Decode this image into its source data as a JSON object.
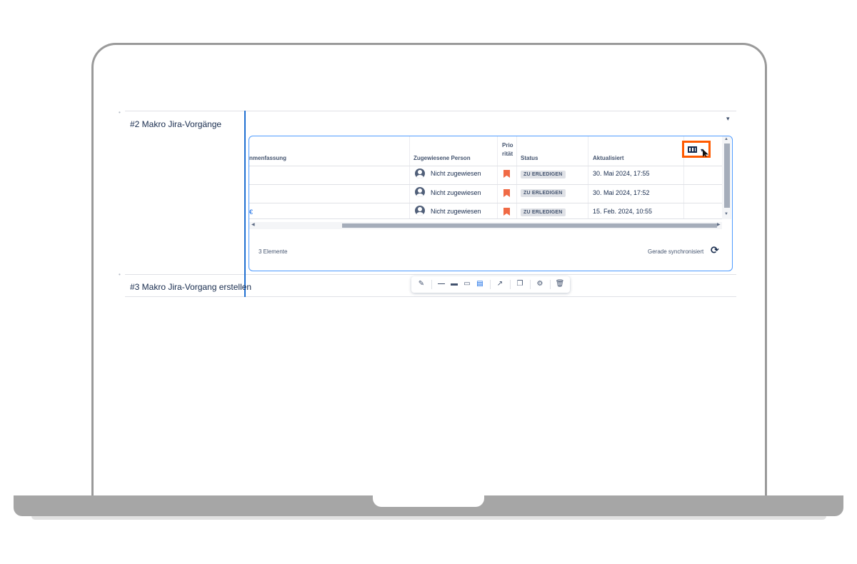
{
  "doc_rows": [
    {
      "label": "#2 Makro Jira-Vorgänge"
    },
    {
      "label": "#3 Makro Jira-Vorgang erstellen"
    }
  ],
  "jira_table": {
    "headers": {
      "summary": "nmenfassung",
      "assignee": "Zugewiesene Person",
      "priority": "Prio\nrität",
      "status": "Status",
      "updated": "Aktualisiert"
    },
    "rows": [
      {
        "summary": "",
        "assignee": "Nicht zugewiesen",
        "status": "ZU ERLEDIGEN",
        "updated": "30. Mai 2024, 17:55"
      },
      {
        "summary": "",
        "assignee": "Nicht zugewiesen",
        "status": "ZU ERLEDIGEN",
        "updated": "30. Mai 2024, 17:52"
      },
      {
        "summary": "€",
        "assignee": "Nicht zugewiesen",
        "status": "ZU ERLEDIGEN",
        "updated": "15. Feb. 2024, 10:55"
      }
    ],
    "footer": {
      "count": "3 Elemente",
      "sync": "Gerade synchronisiert"
    }
  },
  "colors": {
    "highlight": "#ff5a00",
    "priority": "#f06a45",
    "accent": "#1f6fd1"
  },
  "icons": {
    "columns": "columns-icon",
    "sync": "sync-icon",
    "toolbar": [
      "edit-icon",
      "line-icon",
      "inline-card-icon",
      "block-card-icon",
      "embed-table-icon",
      "open-external-icon",
      "copy-icon",
      "settings-icon",
      "delete-icon"
    ]
  }
}
